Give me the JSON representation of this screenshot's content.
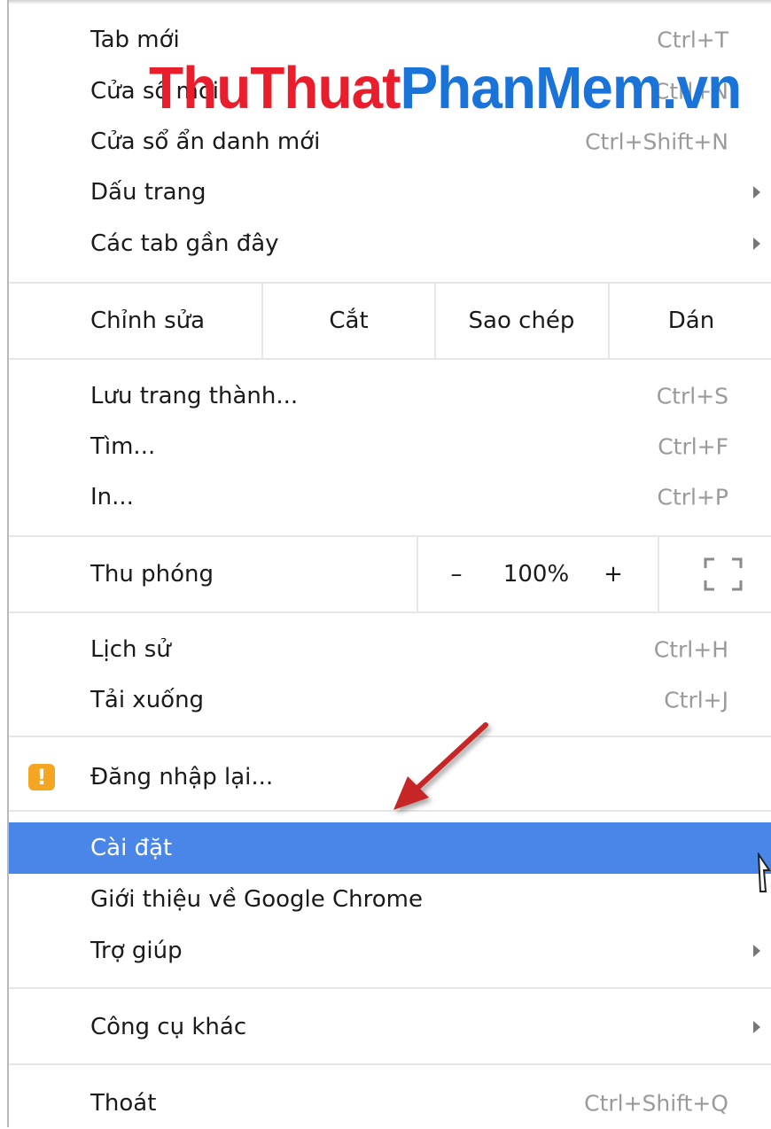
{
  "watermark": {
    "part1": "ThuThuat",
    "part2": "PhanMem.vn"
  },
  "menu": {
    "new_tab": {
      "label": "Tab mới",
      "shortcut": "Ctrl+T"
    },
    "new_window": {
      "label": "Cửa sổ mới",
      "shortcut": "Ctrl+N"
    },
    "incognito": {
      "label": "Cửa sổ ẩn danh mới",
      "shortcut": "Ctrl+Shift+N"
    },
    "bookmarks": {
      "label": "Dấu trang"
    },
    "recent_tabs": {
      "label": "Các tab gần đây"
    },
    "edit": {
      "label": "Chỉnh sửa",
      "cut": "Cắt",
      "copy": "Sao chép",
      "paste": "Dán"
    },
    "save_page": {
      "label": "Lưu trang thành...",
      "shortcut": "Ctrl+S"
    },
    "find": {
      "label": "Tìm...",
      "shortcut": "Ctrl+F"
    },
    "print": {
      "label": "In...",
      "shortcut": "Ctrl+P"
    },
    "zoom": {
      "label": "Thu phóng",
      "minus": "–",
      "level": "100%",
      "plus": "+"
    },
    "history": {
      "label": "Lịch sử",
      "shortcut": "Ctrl+H"
    },
    "downloads": {
      "label": "Tải xuống",
      "shortcut": "Ctrl+J"
    },
    "signin": {
      "label": "Đăng nhập lại...",
      "badge": "!"
    },
    "settings": {
      "label": "Cài đặt"
    },
    "about": {
      "label": "Giới thiệu về Google Chrome"
    },
    "help": {
      "label": "Trợ giúp"
    },
    "more_tools": {
      "label": "Công cụ khác"
    },
    "exit": {
      "label": "Thoát",
      "shortcut": "Ctrl+Shift+Q"
    }
  },
  "colors": {
    "highlight": "#4a86e8",
    "watermark_red": "#ea1d2c",
    "watermark_blue": "#1a73d9",
    "warning": "#f4a623",
    "annotation_arrow": "#c62828"
  },
  "icons": [
    "submenu-arrow-icon",
    "warning-icon",
    "fullscreen-icon",
    "mouse-cursor-icon",
    "annotation-arrow-icon"
  ]
}
